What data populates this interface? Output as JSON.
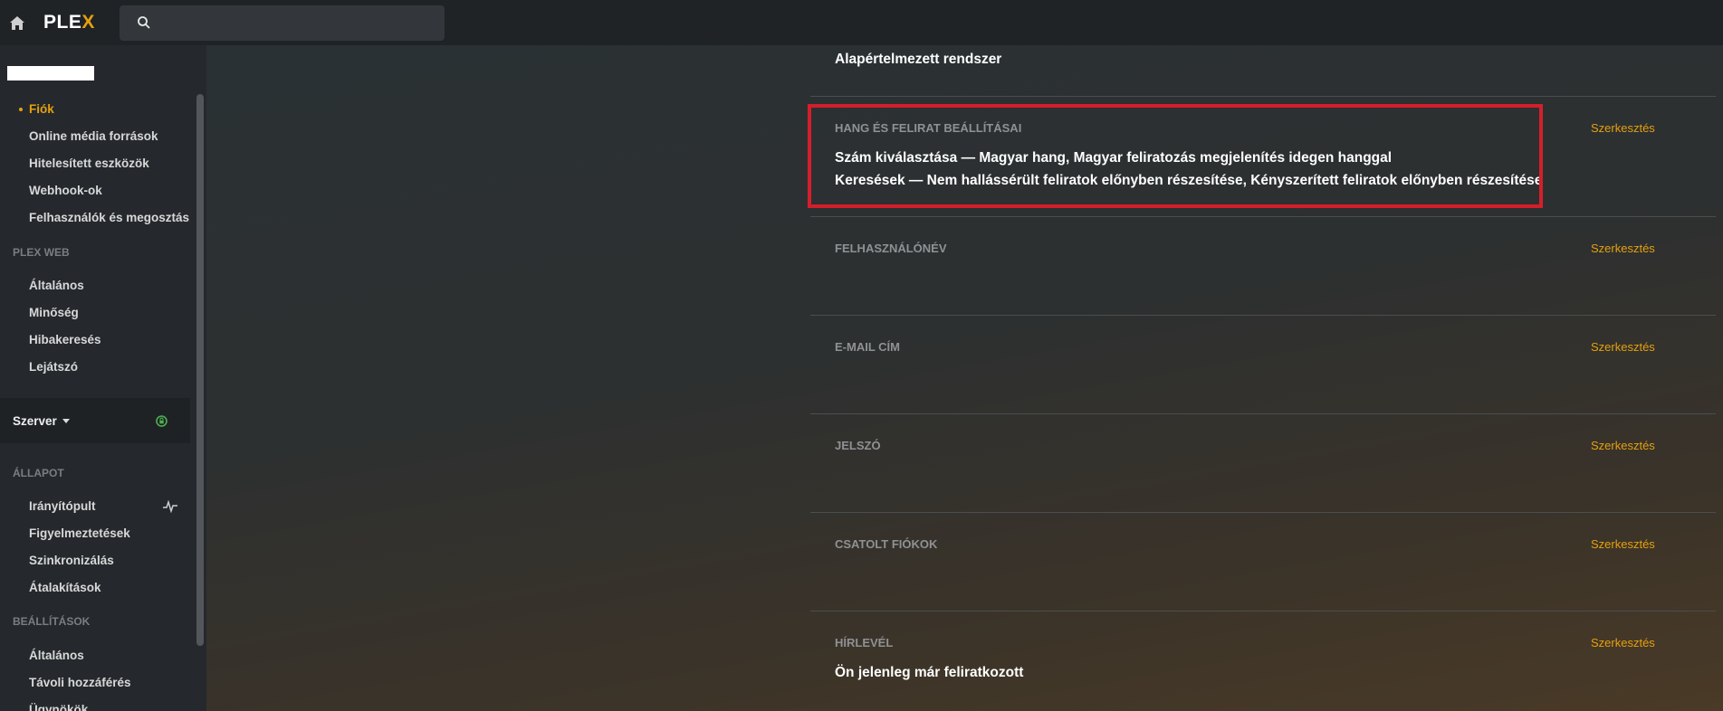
{
  "topbar": {
    "logo_text": "PLE",
    "logo_accent": "X",
    "search_placeholder": ""
  },
  "sidebar": {
    "account_items": [
      {
        "label": "Fiók",
        "active": true
      },
      {
        "label": "Online média források"
      },
      {
        "label": "Hitelesített eszközök"
      },
      {
        "label": "Webhook-ok"
      },
      {
        "label": "Felhasználók és megosztás"
      }
    ],
    "plex_web_section": "PLEX WEB",
    "plex_web_items": [
      {
        "label": "Általános"
      },
      {
        "label": "Minőség"
      },
      {
        "label": "Hibakeresés"
      },
      {
        "label": "Lejátszó"
      }
    ],
    "server": {
      "label": "Szerver"
    },
    "status_section": "ÁLLAPOT",
    "status_items": [
      {
        "label": "Irányítópult"
      },
      {
        "label": "Figyelmeztetések"
      },
      {
        "label": "Szinkronizálás"
      },
      {
        "label": "Átalakítások"
      }
    ],
    "settings_section": "BEÁLLÍTÁSOK",
    "settings_items": [
      {
        "label": "Általános"
      },
      {
        "label": "Távoli hozzáférés"
      },
      {
        "label": "Ügynökök"
      }
    ]
  },
  "main": {
    "top_value": "Alapértelmezett rendszer",
    "edit_label": "Szerkesztés",
    "rows": [
      {
        "title": "HANG ÉS FELIRAT BEÁLLÍTÁSAI",
        "values": [
          "Szám kiválasztása — Magyar hang, Magyar feliratozás megjelenítés idegen hanggal",
          "Keresések — Nem hallássérült feliratok előnyben részesítése, Kényszerített feliratok előnyben részesítése"
        ]
      },
      {
        "title": "FELHASZNÁLÓNÉV",
        "values": []
      },
      {
        "title": "E-MAIL CÍM",
        "values": []
      },
      {
        "title": "JELSZÓ",
        "values": []
      },
      {
        "title": "CSATOLT FIÓKOK",
        "values": []
      },
      {
        "title": "HÍRLEVÉL",
        "values": [
          "Ön jelenleg már feliratkozott"
        ]
      }
    ]
  },
  "colors": {
    "accent": "#e5a00d",
    "highlight": "#d51e2b",
    "server_ok": "#4caf50"
  }
}
